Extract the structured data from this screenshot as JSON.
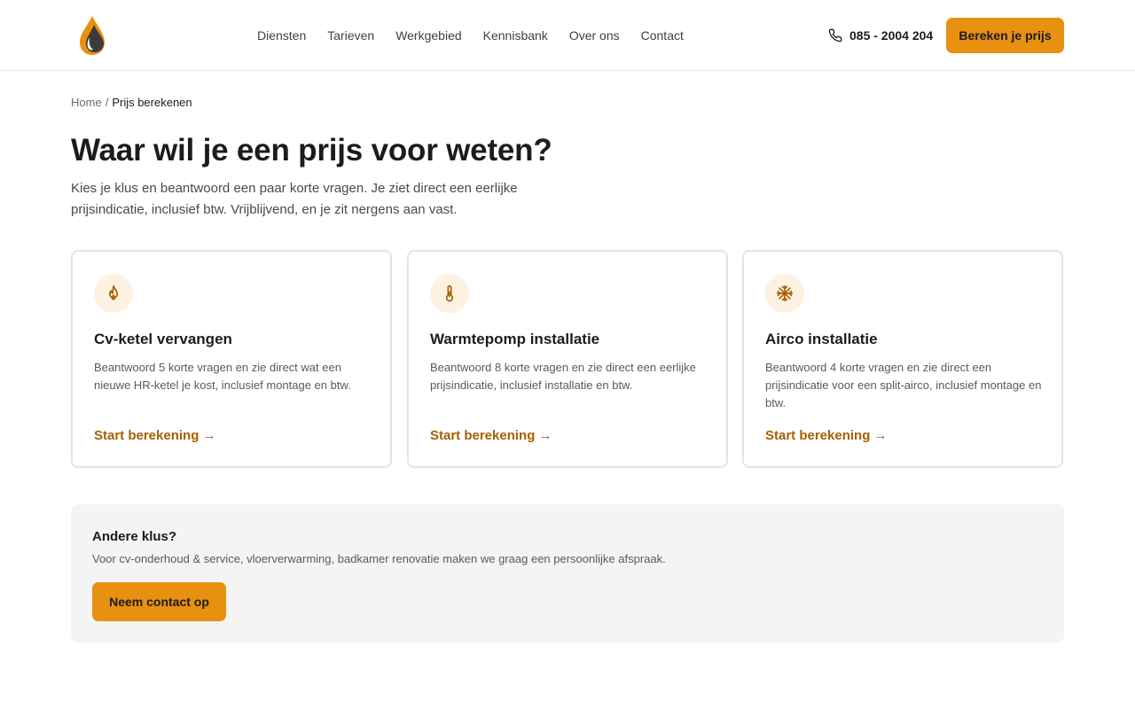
{
  "header": {
    "logo_name": "flame-drop-logo",
    "nav": [
      "Diensten",
      "Tarieven",
      "Werkgebied",
      "Kennisbank",
      "Over ons",
      "Contact"
    ],
    "phone": "085 - 2004 204",
    "cta_label": "Bereken je prijs"
  },
  "breadcrumb": {
    "home": "Home",
    "separator": "/",
    "current": "Prijs berekenen"
  },
  "page": {
    "title": "Waar wil je een prijs voor weten?",
    "intro": "Kies je klus en beantwoord een paar korte vragen. Je ziet direct een eerlijke prijsindicatie, inclusief btw. Vrijblijvend, en je zit nergens aan vast."
  },
  "cards": [
    {
      "icon": "flame-icon",
      "title": "Cv-ketel vervangen",
      "description": "Beantwoord 5 korte vragen en zie direct wat een nieuwe HR-ketel je kost, inclusief montage en btw.",
      "link": "Start berekening →"
    },
    {
      "icon": "thermometer-icon",
      "title": "Warmtepomp installatie",
      "description": "Beantwoord 8 korte vragen en zie direct een eerlijke prijsindicatie, inclusief installatie en btw.",
      "link": "Start berekening →"
    },
    {
      "icon": "snowflake-icon",
      "title": "Airco installatie",
      "description": "Beantwoord 4 korte vragen en zie direct een prijsindicatie voor een split-airco, inclusief montage en btw.",
      "link": "Start berekening →"
    }
  ],
  "other": {
    "title": "Andere klus?",
    "text": "Voor cv-onderhoud & service, vloerverwarming, badkamer renovatie maken we graag een persoonlijke afspraak.",
    "button": "Neem contact op"
  },
  "colors": {
    "accent": "#e8900f",
    "link": "#a65f00",
    "icon_bg": "#fdf1e1",
    "panel_bg": "#f4f4f4"
  }
}
